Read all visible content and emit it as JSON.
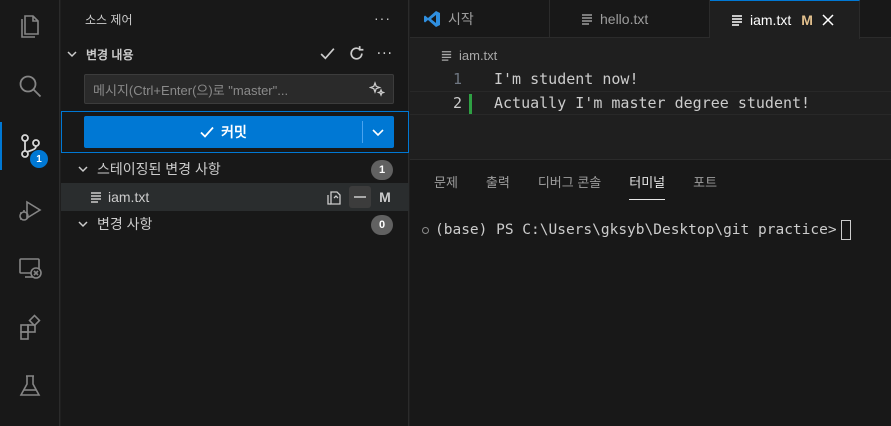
{
  "activity_bar": {
    "items": [
      {
        "name": "explorer",
        "icon": "files-icon"
      },
      {
        "name": "search",
        "icon": "search-icon"
      },
      {
        "name": "source-control",
        "icon": "source-control-icon",
        "badge": "1",
        "active": true
      },
      {
        "name": "run-debug",
        "icon": "debug-icon"
      },
      {
        "name": "remote-explorer",
        "icon": "remote-icon"
      },
      {
        "name": "extensions",
        "icon": "extensions-icon"
      },
      {
        "name": "testing",
        "icon": "flask-icon"
      }
    ]
  },
  "sidebar": {
    "title": "소스 제어",
    "more": "···",
    "section_title": "변경 내용",
    "message_placeholder": "메시지(Ctrl+Enter(으)로 \"master\"...",
    "commit_label": "커밋",
    "staged_group": {
      "label": "스테이징된 변경 사항",
      "count": "1"
    },
    "staged_file": {
      "name": "iam.txt",
      "status": "M"
    },
    "changes_group": {
      "label": "변경 사항",
      "count": "0"
    }
  },
  "editor": {
    "tabs": [
      {
        "label": "시작",
        "icon": "vscode-logo-icon"
      },
      {
        "label": "hello.txt",
        "icon": "file-lines-icon"
      },
      {
        "label": "iam.txt",
        "icon": "file-lines-icon",
        "mark": "M",
        "active": true
      }
    ],
    "breadcrumb": "iam.txt",
    "lines": [
      {
        "number": "1",
        "text": "I'm student now!"
      },
      {
        "number": "2",
        "text": "Actually I'm master degree student!"
      }
    ]
  },
  "panel": {
    "tabs": [
      "문제",
      "출력",
      "디버그 콘솔",
      "터미널",
      "포트"
    ],
    "active_tab": "터미널",
    "terminal_prompt": "(base) PS C:\\Users\\gksyb\\Desktop\\git practice>"
  },
  "colors": {
    "accent": "#0078d4",
    "modified": "#e2c08d",
    "added_gutter": "#2ea043"
  }
}
